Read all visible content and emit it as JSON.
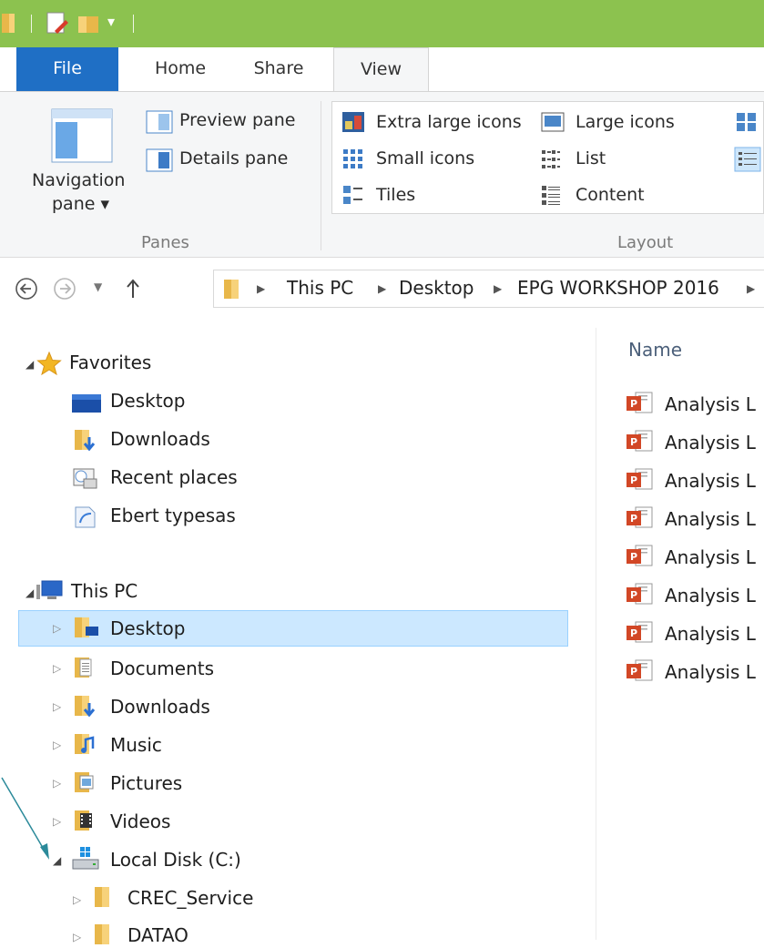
{
  "tabs": {
    "file": "File",
    "home": "Home",
    "share": "Share",
    "view": "View"
  },
  "ribbon": {
    "navigation_pane": "Navigation",
    "navigation_pane_line2": "pane ▾",
    "preview_pane": "Preview pane",
    "details_pane": "Details pane",
    "panes_group": "Panes",
    "extra_large_icons": "Extra large icons",
    "large_icons": "Large icons",
    "small_icons": "Small icons",
    "list": "List",
    "tiles": "Tiles",
    "content": "Content",
    "layout_group": "Layout"
  },
  "address": {
    "crumbs": [
      "This PC",
      "Desktop",
      "EPG WORKSHOP 2016"
    ]
  },
  "nav": {
    "favorites": "Favorites",
    "fav_items": [
      "Desktop",
      "Downloads",
      "Recent places",
      "Ebert typesas"
    ],
    "this_pc": "This PC",
    "pc_items": [
      "Desktop",
      "Documents",
      "Downloads",
      "Music",
      "Pictures",
      "Videos",
      "Local Disk (C:)"
    ],
    "disk_items": [
      "CREC_Service",
      "DATAO"
    ]
  },
  "content": {
    "column_name": "Name",
    "files": [
      "Analysis L",
      "Analysis L",
      "Analysis L",
      "Analysis L",
      "Analysis L",
      "Analysis L",
      "Analysis L",
      "Analysis L"
    ]
  },
  "colors": {
    "titlebar": "#8cc24f",
    "file_tab": "#1f6fc5",
    "selection": "#cce8ff",
    "annotation_arrow": "#2b8a9a"
  }
}
